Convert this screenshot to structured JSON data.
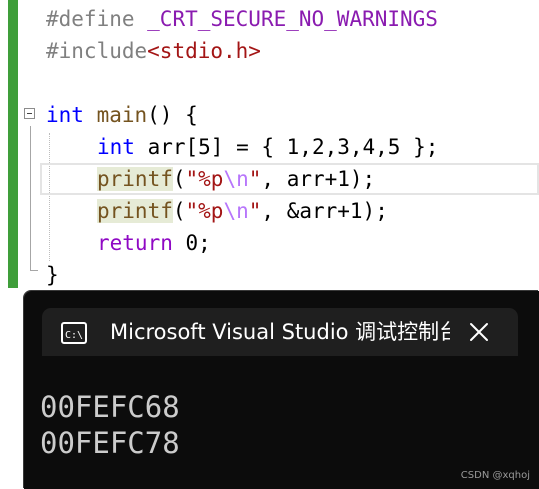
{
  "editor": {
    "line1": {
      "directive": "#define",
      "macro": " _CRT_SECURE_NO_WARNINGS"
    },
    "line2": {
      "directive": "#include",
      "header": "<stdio.h>"
    },
    "line4": {
      "type": "int",
      "name": " main",
      "rest": "() {"
    },
    "line5": {
      "type": "int",
      "rest": " arr[5] = { 1,2,3,4,5 };"
    },
    "line6": {
      "fn": "printf",
      "open": "(",
      "q1": "\"%p",
      "esc": "\\n",
      "q2": "\"",
      "args": ", arr+1);"
    },
    "line7": {
      "fn": "printf",
      "open": "(",
      "q1": "\"%p",
      "esc": "\\n",
      "q2": "\"",
      "args": ", &arr+1);"
    },
    "line8": {
      "kw": "return",
      "rest": " 0;"
    },
    "line9": {
      "text": "}"
    }
  },
  "console": {
    "title": "Microsoft Visual Studio 调试控制台",
    "output": [
      "00FEFC68",
      "00FEFC78"
    ]
  },
  "watermark": "CSDN @xqhoj",
  "colors": {
    "gutter_change": "#3f9e3a",
    "keyword": "#0000ff",
    "string": "#a31515",
    "macro": "#8a1bb0",
    "console_bg": "#0c0c0c",
    "console_tab": "#1f1f1f"
  },
  "icons": {
    "console_icon": "terminal-icon",
    "close": "close-icon"
  }
}
